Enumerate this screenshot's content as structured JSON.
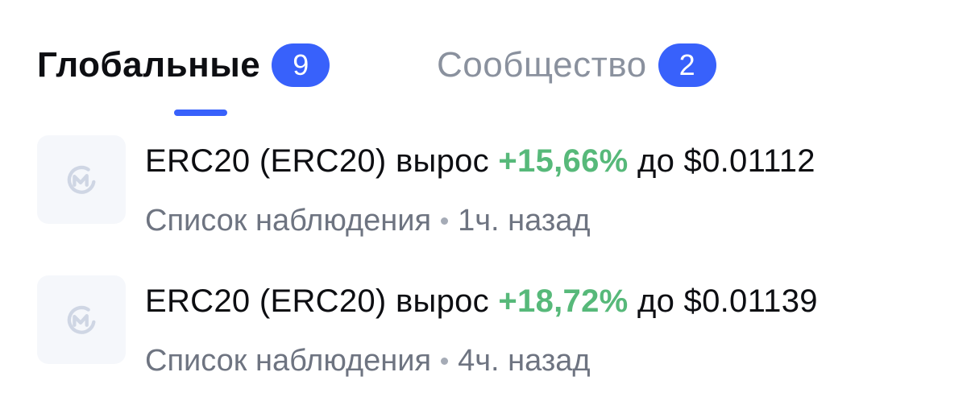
{
  "tabs": [
    {
      "label": "Глобальные",
      "badge": "9",
      "active": true
    },
    {
      "label": "Сообщество",
      "badge": "2",
      "active": false
    }
  ],
  "notifications": [
    {
      "icon": "coinmarketcap-logo-icon",
      "asset": "ERC20 (ERC20)",
      "action": "вырос",
      "change": "+15,66%",
      "preposition": "до",
      "price": "$0.01112",
      "source": "Список наблюдения",
      "time": "1ч. назад"
    },
    {
      "icon": "coinmarketcap-logo-icon",
      "asset": "ERC20 (ERC20)",
      "action": "вырос",
      "change": "+18,72%",
      "preposition": "до",
      "price": "$0.01139",
      "source": "Список наблюдения",
      "time": "4ч. назад"
    }
  ],
  "colors": {
    "accent": "#3861fb",
    "positive": "#57b97a",
    "text_primary": "#0d0e12",
    "text_secondary": "#6e7481",
    "avatar_bg": "#f5f7fb"
  }
}
